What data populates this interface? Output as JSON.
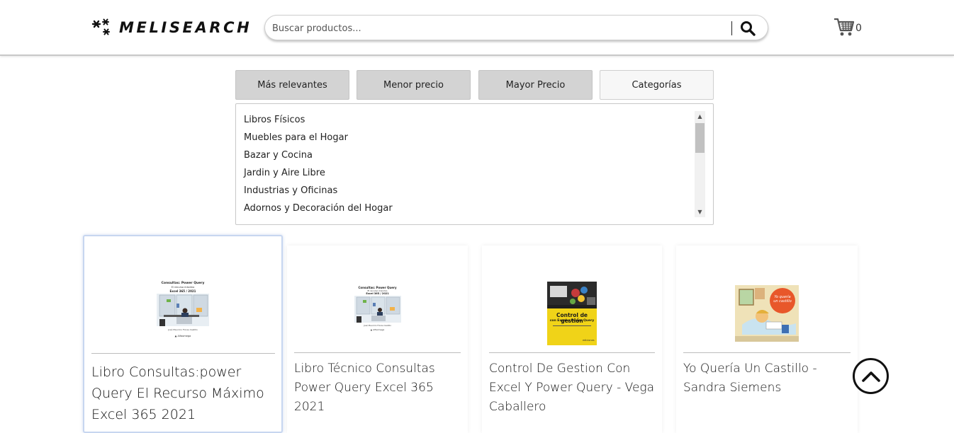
{
  "header": {
    "logo_text": "MELISEARCH",
    "search": {
      "placeholder": "Buscar productos...",
      "value": ""
    },
    "cart_count": "0"
  },
  "sort_buttons": [
    {
      "label": "Más relevantes"
    },
    {
      "label": "Menor precio"
    },
    {
      "label": "Mayor Precio"
    },
    {
      "label": "Categorías"
    }
  ],
  "categories": [
    "Libros Físicos",
    "Muebles para el Hogar",
    "Bazar y Cocina",
    "Jardin y Aire Libre",
    "Industrias y Oficinas",
    "Adornos y Decoración del Hogar"
  ],
  "products": [
    {
      "title": "Libro Consultas:power Query El Recurso Máximo Excel 365 2021",
      "cover": {
        "title": "Consultas: Power Query",
        "subtitle": "El recurso máximo",
        "edition": "Excel 365 / 2021",
        "author": "José Mauricio Flores Castillo",
        "publisher": "Alfaomega"
      }
    },
    {
      "title": "Libro Técnico Consultas Power Query Excel 365 2021",
      "cover": {
        "title": "Consultas: Power Query",
        "subtitle": "El recurso máximo",
        "edition": "Excel 365 / 2021",
        "author": "José Mauricio Flores Castillo",
        "publisher": "Alfaomega"
      }
    },
    {
      "title": "Control De Gestion Con Excel Y Power Query - Vega Caballero",
      "cover": {
        "title": "Control de gestión",
        "subtitle": "con Excel y Power Query",
        "publisher": "ediciones"
      }
    },
    {
      "title": "Yo Quería Un Castillo - Sandra Siemens",
      "cover": {
        "title": "Yo quería un castillo"
      }
    }
  ],
  "colors": {
    "button_gray": "#d3d3d3",
    "cover_yellow": "#f0d318",
    "castle_orange": "#e8572a"
  }
}
